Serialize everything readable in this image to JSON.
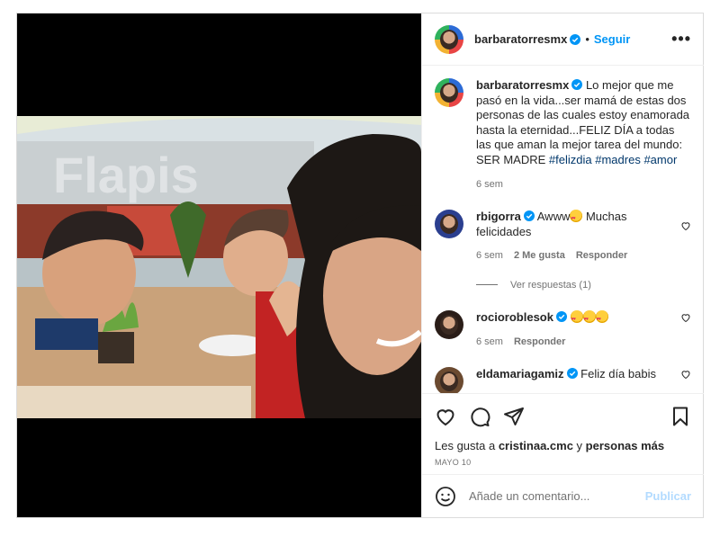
{
  "post": {
    "author": "barbaratorresmx",
    "follow_label": "Seguir",
    "separator": "•",
    "more_label": "•••"
  },
  "caption": {
    "author": "barbaratorresmx",
    "text_before": " Lo mejor que me pasó en la vida...ser mamá de estas dos personas de las cuales estoy enamorada hasta la eternidad...FELIZ DÍA a todas las que aman la mejor tarea del mundo: SER MADRE ",
    "hashtag1": "#felizdia",
    "hashtag2": "#madres",
    "hashtag3": "#amor",
    "time": "6 sem"
  },
  "comments": [
    {
      "user": "rbigorra",
      "text_before": " Awww",
      "text_after": " Muchas felicidades",
      "time": "6 sem",
      "likes": "2 Me gusta",
      "reply": "Responder"
    },
    {
      "user": "rocioroblesok",
      "time": "6 sem",
      "reply": "Responder"
    },
    {
      "user": "eldamariagamiz",
      "text": " Feliz día babis"
    }
  ],
  "view_replies": "Ver respuestas (1)",
  "likes": {
    "prefix": "Les gusta a ",
    "user": "cristinaa.cmc",
    "middle": " y ",
    "others": "personas más"
  },
  "date": "MAYO 10",
  "composer": {
    "placeholder": "Añade un comentario...",
    "publish": "Publicar"
  },
  "colors": {
    "accent": "#0095f6",
    "verified": "#0095f6",
    "publish_disabled": "#b3dbff"
  },
  "icons": [
    "heart-icon",
    "comment-icon",
    "share-icon",
    "bookmark-icon",
    "emoji-icon",
    "verified-badge-icon"
  ]
}
